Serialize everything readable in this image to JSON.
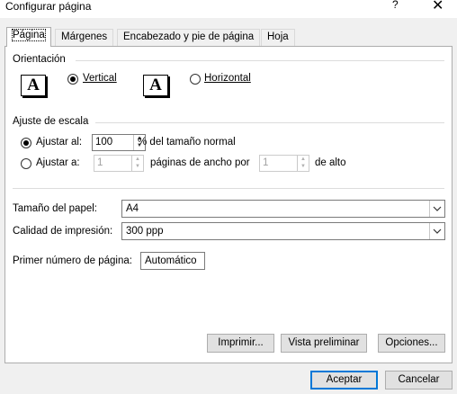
{
  "window": {
    "title": "Configurar página",
    "help_glyph": "?",
    "close_glyph": "✕"
  },
  "tabs": [
    {
      "label": "Página"
    },
    {
      "label": "Márgenes"
    },
    {
      "label": "Encabezado y pie de página"
    },
    {
      "label": "Hoja"
    }
  ],
  "orientation": {
    "title": "Orientación",
    "icon_glyph": "A",
    "vertical_label": "Vertical",
    "horizontal_label": "Horizontal",
    "selected": "Vertical"
  },
  "scaling": {
    "title": "Ajuste de escala",
    "adjust_to_label": "Ajustar al:",
    "adjust_to_value": "100",
    "adjust_to_suffix": "% del tamaño normal",
    "fit_to_label": "Ajustar a:",
    "fit_wide_value": "1",
    "fit_wide_suffix": "páginas de ancho por",
    "fit_tall_value": "1",
    "fit_tall_suffix": "de alto",
    "selected": "Ajustar al:"
  },
  "paper": {
    "size_label": "Tamaño del papel:",
    "size_value": "A4",
    "quality_label": "Calidad de impresión:",
    "quality_value": "300 ppp",
    "first_page_label": "Primer número de página:",
    "first_page_value": "Automático"
  },
  "buttons": {
    "print": "Imprimir...",
    "preview": "Vista preliminar",
    "options": "Opciones...",
    "ok": "Aceptar",
    "cancel": "Cancelar"
  },
  "icons": {
    "spin_up": "▲",
    "spin_down": "▼",
    "dropdown": "chevron-down-icon"
  }
}
